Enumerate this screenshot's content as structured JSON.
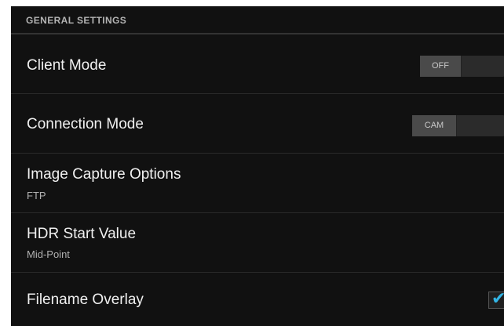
{
  "section": {
    "title": "GENERAL SETTINGS"
  },
  "settings": [
    {
      "title": "Client Mode",
      "control": "toggle",
      "value": "OFF"
    },
    {
      "title": "Connection Mode",
      "control": "toggle",
      "value": "CAM"
    },
    {
      "title": "Image Capture Options",
      "summary": "FTP"
    },
    {
      "title": "HDR Start Value",
      "summary": "Mid-Point"
    },
    {
      "title": "Filename Overlay",
      "control": "checkbox",
      "checked": true
    }
  ],
  "colors": {
    "background": "#111111",
    "accent": "#33b5e5",
    "divider": "#2a2a2a"
  },
  "icons": {
    "check": "check-icon"
  }
}
